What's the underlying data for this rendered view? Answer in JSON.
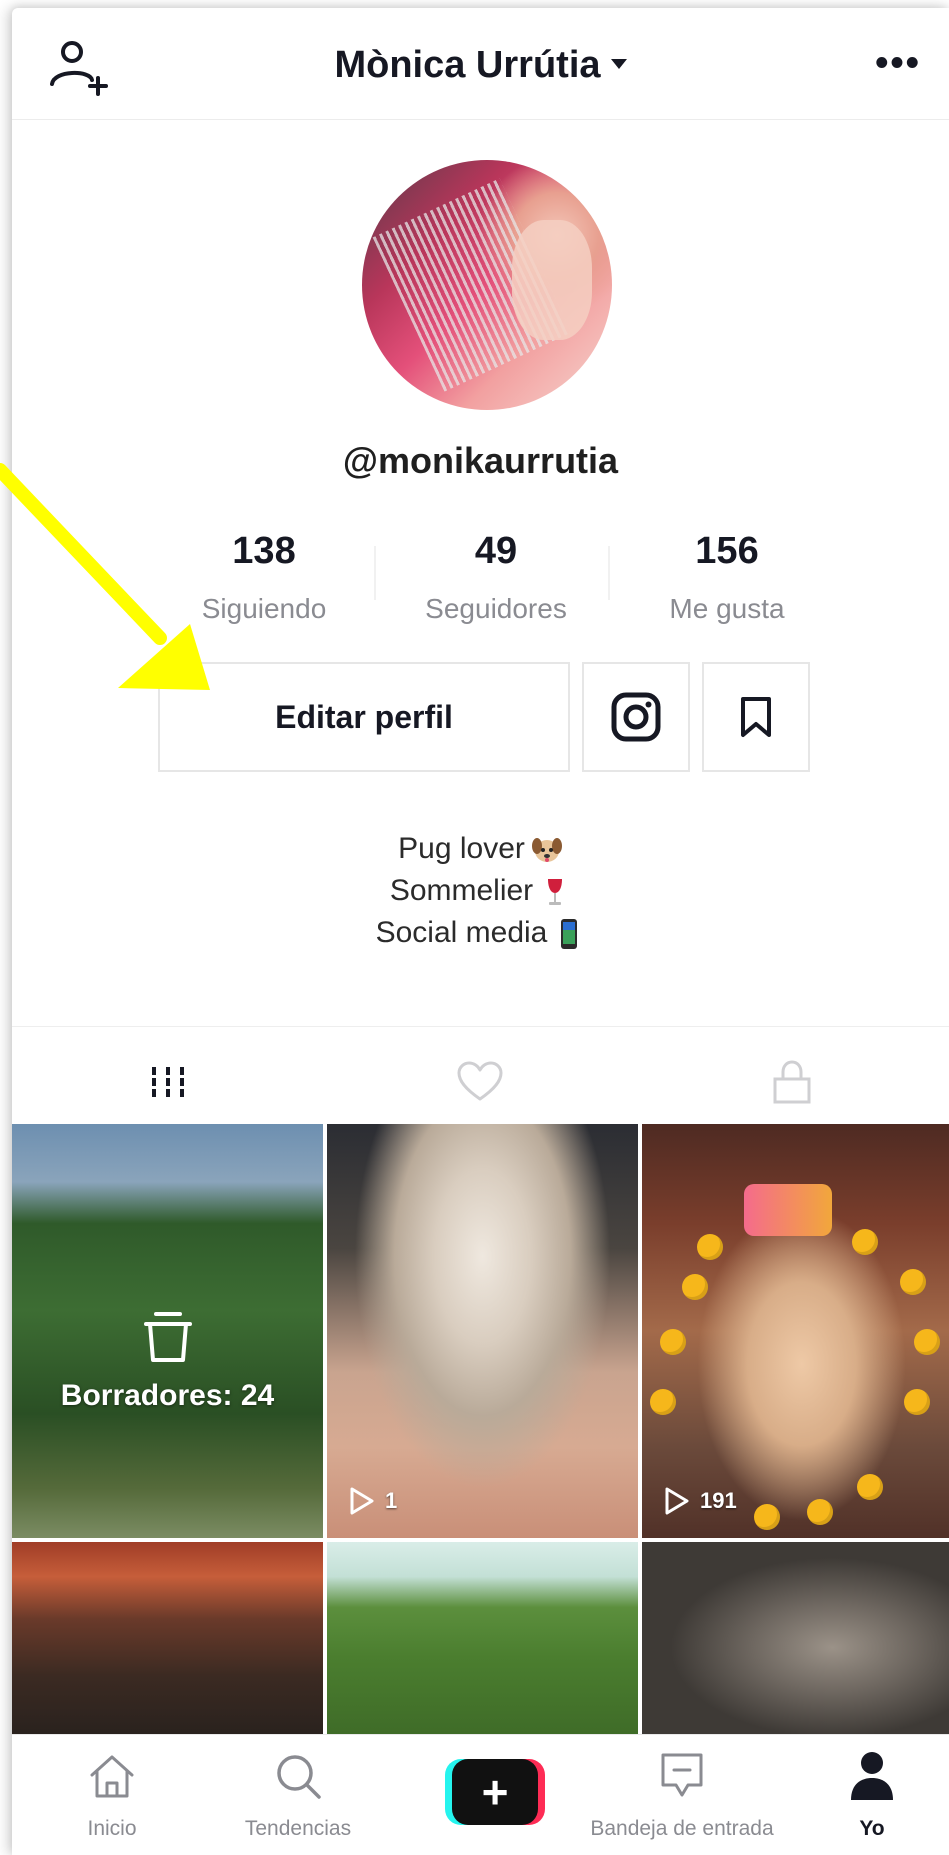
{
  "header": {
    "title": "Mònica Urrútia",
    "add_user_icon": "add-user-icon",
    "more_icon": "more-icon",
    "more_glyph": "•••"
  },
  "profile": {
    "username": "@monikaurrutia",
    "stats": [
      {
        "value": "138",
        "label": "Siguiendo"
      },
      {
        "value": "49",
        "label": "Seguidores"
      },
      {
        "value": "156",
        "label": "Me gusta"
      }
    ],
    "edit_button": "Editar perfil",
    "bio": [
      {
        "text": "Pug lover",
        "emoji": "dog-face"
      },
      {
        "text": "Sommelier",
        "emoji": "wine-glass"
      },
      {
        "text": "Social media",
        "emoji": "mobile-phone"
      }
    ]
  },
  "tabs": [
    {
      "icon": "grid-icon",
      "active": true
    },
    {
      "icon": "heart-icon",
      "active": false
    },
    {
      "icon": "lock-icon",
      "active": false
    }
  ],
  "grid": {
    "drafts_label": "Borradores: 24",
    "videos": [
      {
        "plays": "1"
      },
      {
        "plays": "191"
      }
    ]
  },
  "nav": {
    "items": [
      {
        "label": "Inicio",
        "icon": "home-icon"
      },
      {
        "label": "Tendencias",
        "icon": "search-icon"
      },
      {
        "label": "",
        "icon": "create-icon"
      },
      {
        "label": "Bandeja de entrada",
        "icon": "inbox-icon"
      },
      {
        "label": "Yo",
        "icon": "profile-icon",
        "active": true
      }
    ]
  },
  "colors": {
    "text_primary": "#161823",
    "text_secondary": "#8a8b91",
    "annotation_arrow": "#ffff00",
    "create_cyan": "#25f4ee",
    "create_red": "#fe2c55"
  }
}
